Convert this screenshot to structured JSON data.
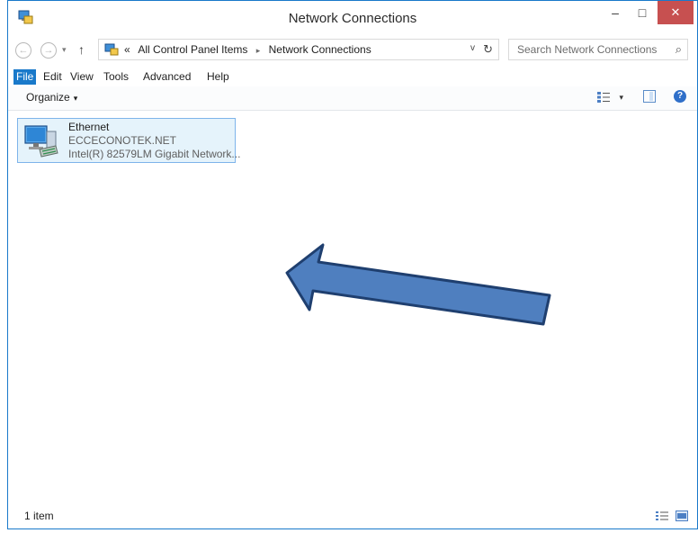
{
  "window": {
    "title": "Network Connections",
    "minimize": "–",
    "maximize": "□",
    "close": "✕"
  },
  "address": {
    "back": "←",
    "forward": "→",
    "recent": "▾",
    "up": "↑",
    "overflow": "«",
    "crumbs": [
      "All Control Panel Items",
      "Network Connections"
    ],
    "separator": "▸",
    "dropdown": "v",
    "refresh": "↻",
    "search_placeholder": "Search Network Connections",
    "search_icon": "⌕"
  },
  "menu": {
    "file": "File",
    "edit": "Edit",
    "view": "View",
    "tools": "Tools",
    "advanced": "Advanced",
    "help": "Help"
  },
  "commands": {
    "organize": "Organize",
    "caret": "▾",
    "help_glyph": "?"
  },
  "items": [
    {
      "name": "Ethernet",
      "status": "ECCECONOTEK.NET",
      "device": "Intel(R) 82579LM Gigabit Network..."
    }
  ],
  "statusbar": {
    "count": "1 item"
  },
  "colors": {
    "accent": "#1979ca",
    "selection_bg": "#e5f3fb",
    "selection_border": "#7eb4ea",
    "arrow_fill": "#4f7fbf",
    "arrow_stroke": "#1f3f6f",
    "close_button": "#c75050"
  }
}
